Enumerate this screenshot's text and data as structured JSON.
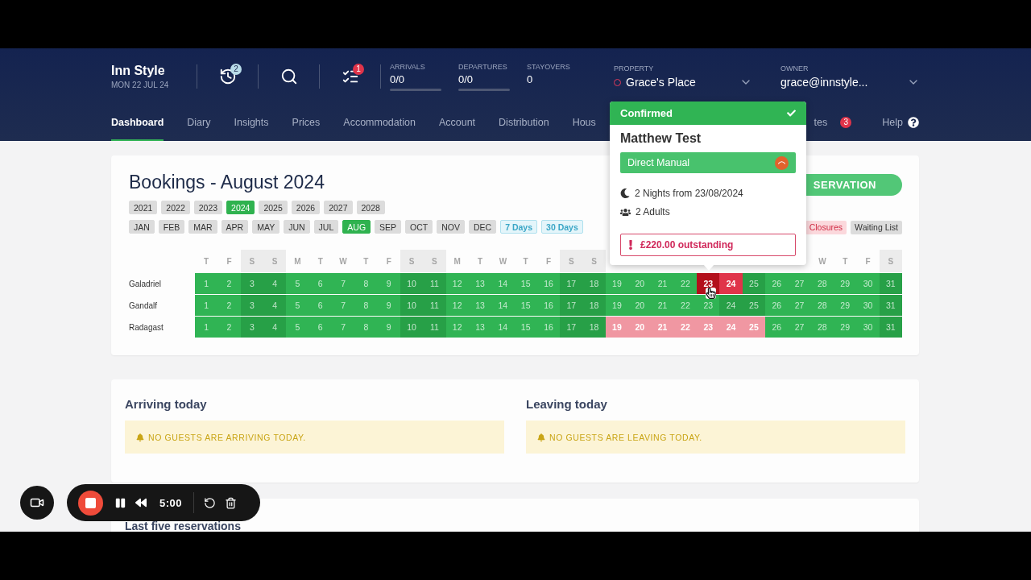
{
  "header": {
    "brand": "Inn Style",
    "date": "MON 22 JUL 24",
    "tools": [
      {
        "kind": "clock",
        "badge": "2"
      },
      {
        "kind": "search"
      },
      {
        "kind": "tasks",
        "badge": "1"
      }
    ],
    "stats": [
      {
        "label": "ARRIVALS",
        "value": "0/0",
        "kind": "bar"
      },
      {
        "label": "DEPARTURES",
        "value": "0/0",
        "kind": "bar"
      },
      {
        "label": "STAYOVERS",
        "value": "0",
        "kind": "plain"
      }
    ],
    "property": {
      "label": "PROPERTY",
      "value": "Grace's Place"
    },
    "owner": {
      "label": "OWNER",
      "value": "grace@innstyle..."
    }
  },
  "nav_left": [
    {
      "label": "Dashboard",
      "selected": true
    },
    {
      "label": "Diary",
      "selected": false
    },
    {
      "label": "Insights",
      "selected": false
    },
    {
      "label": "Prices",
      "selected": false
    },
    {
      "label": "Accommodation",
      "selected": false
    },
    {
      "label": "Account",
      "selected": false
    },
    {
      "label": "Distribution",
      "selected": false
    },
    {
      "label": "Hous",
      "selected": false
    }
  ],
  "nav_right": [
    {
      "label": "tes",
      "selected": false,
      "badge": "3"
    },
    {
      "label": "Help",
      "selected": false,
      "kind": "help"
    }
  ],
  "bookings": {
    "title": "Bookings - August 2024",
    "years": [
      {
        "label": "2021",
        "selected": false
      },
      {
        "label": "2022",
        "selected": false
      },
      {
        "label": "2023",
        "selected": false
      },
      {
        "label": "2024",
        "selected": true
      },
      {
        "label": "2025",
        "selected": false
      },
      {
        "label": "2026",
        "selected": false
      },
      {
        "label": "2027",
        "selected": false
      },
      {
        "label": "2028",
        "selected": false
      }
    ],
    "months": [
      {
        "label": "JAN",
        "selected": false,
        "kind": "month"
      },
      {
        "label": "FEB",
        "selected": false,
        "kind": "month"
      },
      {
        "label": "MAR",
        "selected": false,
        "kind": "month"
      },
      {
        "label": "APR",
        "selected": false,
        "kind": "month"
      },
      {
        "label": "MAY",
        "selected": false,
        "kind": "month"
      },
      {
        "label": "JUN",
        "selected": false,
        "kind": "month"
      },
      {
        "label": "JUL",
        "selected": false,
        "kind": "month"
      },
      {
        "label": "AUG",
        "selected": true,
        "kind": "month"
      },
      {
        "label": "SEP",
        "selected": false,
        "kind": "month"
      },
      {
        "label": "OCT",
        "selected": false,
        "kind": "month"
      },
      {
        "label": "NOV",
        "selected": false,
        "kind": "month"
      },
      {
        "label": "DEC",
        "selected": false,
        "kind": "month"
      },
      {
        "label": "7 Days",
        "selected": false,
        "kind": "range"
      },
      {
        "label": "30 Days",
        "selected": false,
        "kind": "range"
      }
    ],
    "action_button": "SERVATION",
    "legend": [
      {
        "label": "Closures",
        "kind": "closure"
      },
      {
        "label": "Waiting List",
        "kind": "waiting"
      }
    ],
    "day_headers": [
      {
        "label": "T",
        "weekend": false
      },
      {
        "label": "F",
        "weekend": false
      },
      {
        "label": "S",
        "weekend": true
      },
      {
        "label": "S",
        "weekend": true
      },
      {
        "label": "M",
        "weekend": false
      },
      {
        "label": "T",
        "weekend": false
      },
      {
        "label": "W",
        "weekend": false
      },
      {
        "label": "T",
        "weekend": false
      },
      {
        "label": "F",
        "weekend": false
      },
      {
        "label": "S",
        "weekend": true
      },
      {
        "label": "S",
        "weekend": true
      },
      {
        "label": "M",
        "weekend": false
      },
      {
        "label": "T",
        "weekend": false
      },
      {
        "label": "W",
        "weekend": false
      },
      {
        "label": "T",
        "weekend": false
      },
      {
        "label": "F",
        "weekend": false
      },
      {
        "label": "S",
        "weekend": true
      },
      {
        "label": "S",
        "weekend": true
      }
    ],
    "day_headers_end": [
      {
        "label": "W",
        "weekend": false
      },
      {
        "label": "T",
        "weekend": false
      },
      {
        "label": "F",
        "weekend": false
      },
      {
        "label": "S",
        "weekend": true
      }
    ],
    "rows": [
      {
        "name": "Galadriel",
        "cells": [
          {
            "day": "1",
            "kind": "free",
            "weekend": false
          },
          {
            "day": "2",
            "kind": "free",
            "weekend": false
          },
          {
            "day": "3",
            "kind": "free",
            "weekend": true
          },
          {
            "day": "4",
            "kind": "free",
            "weekend": true
          },
          {
            "day": "5",
            "kind": "free",
            "weekend": false
          },
          {
            "day": "6",
            "kind": "free",
            "weekend": false
          },
          {
            "day": "7",
            "kind": "free",
            "weekend": false
          },
          {
            "day": "8",
            "kind": "free",
            "weekend": false
          },
          {
            "day": "9",
            "kind": "free",
            "weekend": false
          },
          {
            "day": "10",
            "kind": "free",
            "weekend": true
          },
          {
            "day": "11",
            "kind": "free",
            "weekend": true
          },
          {
            "day": "12",
            "kind": "free",
            "weekend": false
          },
          {
            "day": "13",
            "kind": "free",
            "weekend": false
          },
          {
            "day": "14",
            "kind": "free",
            "weekend": false
          },
          {
            "day": "15",
            "kind": "free",
            "weekend": false
          },
          {
            "day": "16",
            "kind": "free",
            "weekend": false
          },
          {
            "day": "17",
            "kind": "free",
            "weekend": true
          },
          {
            "day": "18",
            "kind": "free",
            "weekend": true
          },
          {
            "day": "19",
            "kind": "free",
            "weekend": false
          },
          {
            "day": "20",
            "kind": "free",
            "weekend": false
          },
          {
            "day": "21",
            "kind": "free",
            "weekend": false
          },
          {
            "day": "22",
            "kind": "free",
            "weekend": false
          },
          {
            "day": "23",
            "kind": "current"
          },
          {
            "day": "24",
            "kind": "booked"
          },
          {
            "day": "25",
            "kind": "free",
            "weekend": true
          },
          {
            "day": "26",
            "kind": "free",
            "weekend": false
          },
          {
            "day": "27",
            "kind": "free",
            "weekend": false
          },
          {
            "day": "28",
            "kind": "free",
            "weekend": false
          },
          {
            "day": "29",
            "kind": "free",
            "weekend": false
          },
          {
            "day": "30",
            "kind": "free",
            "weekend": false
          },
          {
            "day": "31",
            "kind": "free",
            "weekend": true
          }
        ]
      },
      {
        "name": "Gandalf",
        "cells": [
          {
            "day": "1",
            "kind": "free",
            "weekend": false
          },
          {
            "day": "2",
            "kind": "free",
            "weekend": false
          },
          {
            "day": "3",
            "kind": "free",
            "weekend": true
          },
          {
            "day": "4",
            "kind": "free",
            "weekend": true
          },
          {
            "day": "5",
            "kind": "free",
            "weekend": false
          },
          {
            "day": "6",
            "kind": "free",
            "weekend": false
          },
          {
            "day": "7",
            "kind": "free",
            "weekend": false
          },
          {
            "day": "8",
            "kind": "free",
            "weekend": false
          },
          {
            "day": "9",
            "kind": "free",
            "weekend": false
          },
          {
            "day": "10",
            "kind": "free",
            "weekend": true
          },
          {
            "day": "11",
            "kind": "free",
            "weekend": true
          },
          {
            "day": "12",
            "kind": "free",
            "weekend": false
          },
          {
            "day": "13",
            "kind": "free",
            "weekend": false
          },
          {
            "day": "14",
            "kind": "free",
            "weekend": false
          },
          {
            "day": "15",
            "kind": "free",
            "weekend": false
          },
          {
            "day": "16",
            "kind": "free",
            "weekend": false
          },
          {
            "day": "17",
            "kind": "free",
            "weekend": true
          },
          {
            "day": "18",
            "kind": "free",
            "weekend": true
          },
          {
            "day": "19",
            "kind": "free",
            "weekend": false
          },
          {
            "day": "20",
            "kind": "free",
            "weekend": false
          },
          {
            "day": "21",
            "kind": "free",
            "weekend": false
          },
          {
            "day": "22",
            "kind": "free",
            "weekend": false
          },
          {
            "day": "23",
            "kind": "free",
            "weekend": false
          },
          {
            "day": "24",
            "kind": "free",
            "weekend": true
          },
          {
            "day": "25",
            "kind": "free",
            "weekend": true
          },
          {
            "day": "26",
            "kind": "free",
            "weekend": false
          },
          {
            "day": "27",
            "kind": "free",
            "weekend": false
          },
          {
            "day": "28",
            "kind": "free",
            "weekend": false
          },
          {
            "day": "29",
            "kind": "free",
            "weekend": false
          },
          {
            "day": "30",
            "kind": "free",
            "weekend": false
          },
          {
            "day": "31",
            "kind": "free",
            "weekend": true
          }
        ]
      },
      {
        "name": "Radagast",
        "cells": [
          {
            "day": "1",
            "kind": "free",
            "weekend": false
          },
          {
            "day": "2",
            "kind": "free",
            "weekend": false
          },
          {
            "day": "3",
            "kind": "free",
            "weekend": true
          },
          {
            "day": "4",
            "kind": "free",
            "weekend": true
          },
          {
            "day": "5",
            "kind": "free",
            "weekend": false
          },
          {
            "day": "6",
            "kind": "free",
            "weekend": false
          },
          {
            "day": "7",
            "kind": "free",
            "weekend": false
          },
          {
            "day": "8",
            "kind": "free",
            "weekend": false
          },
          {
            "day": "9",
            "kind": "free",
            "weekend": false
          },
          {
            "day": "10",
            "kind": "free",
            "weekend": true
          },
          {
            "day": "11",
            "kind": "free",
            "weekend": true
          },
          {
            "day": "12",
            "kind": "free",
            "weekend": false
          },
          {
            "day": "13",
            "kind": "free",
            "weekend": false
          },
          {
            "day": "14",
            "kind": "free",
            "weekend": false
          },
          {
            "day": "15",
            "kind": "free",
            "weekend": false
          },
          {
            "day": "16",
            "kind": "free",
            "weekend": false
          },
          {
            "day": "17",
            "kind": "free",
            "weekend": true
          },
          {
            "day": "18",
            "kind": "free",
            "weekend": true
          },
          {
            "day": "19",
            "kind": "provisional"
          },
          {
            "day": "20",
            "kind": "provisional"
          },
          {
            "day": "21",
            "kind": "provisional"
          },
          {
            "day": "22",
            "kind": "provisional"
          },
          {
            "day": "23",
            "kind": "provisional"
          },
          {
            "day": "24",
            "kind": "provisional"
          },
          {
            "day": "25",
            "kind": "provisional"
          },
          {
            "day": "26",
            "kind": "free",
            "weekend": false
          },
          {
            "day": "27",
            "kind": "free",
            "weekend": false
          },
          {
            "day": "28",
            "kind": "free",
            "weekend": false
          },
          {
            "day": "29",
            "kind": "free",
            "weekend": false
          },
          {
            "day": "30",
            "kind": "free",
            "weekend": false
          },
          {
            "day": "31",
            "kind": "free",
            "weekend": true
          }
        ]
      }
    ]
  },
  "popover": {
    "status": "Confirmed",
    "guest": "Matthew Test",
    "source": "Direct Manual",
    "nights": "2 Nights from 23/08/2024",
    "guests": "2 Adults",
    "alert": "£220.00 outstanding"
  },
  "today": [
    {
      "title": "Arriving today",
      "message": "NO GUESTS ARE ARRIVING TODAY."
    },
    {
      "title": "Leaving today",
      "message": "NO GUESTS ARE LEAVING TODAY."
    }
  ],
  "recent": {
    "title": "Last five reservations"
  },
  "recorder": {
    "time": "5:00"
  }
}
